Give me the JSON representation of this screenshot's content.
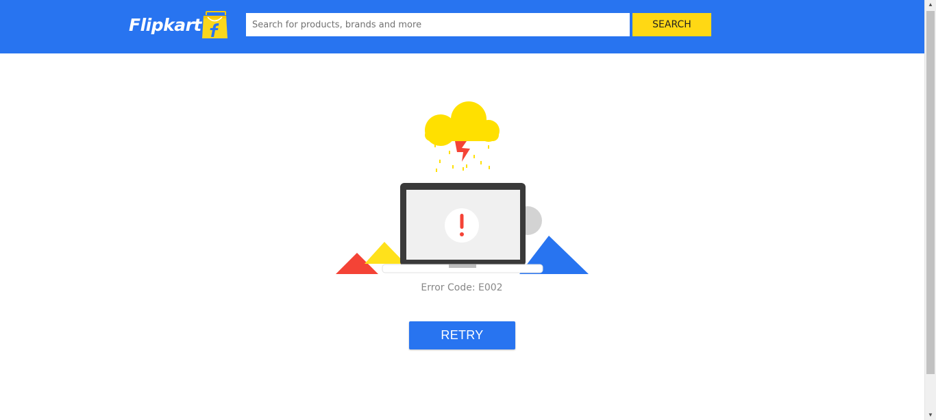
{
  "header": {
    "logo_text": "Flipkart",
    "logo_icon": "flipkart-bag-icon",
    "search_placeholder": "Search for products, brands and more",
    "search_value": "",
    "search_button_label": "SEARCH"
  },
  "error": {
    "illustration": "laptop-error-icon",
    "code_text": "Error Code: E002",
    "retry_label": "RETRY"
  },
  "colors": {
    "brand_blue": "#2874f0",
    "brand_yellow": "#ffe11b",
    "error_red": "#f44336",
    "text_gray": "#878787"
  }
}
